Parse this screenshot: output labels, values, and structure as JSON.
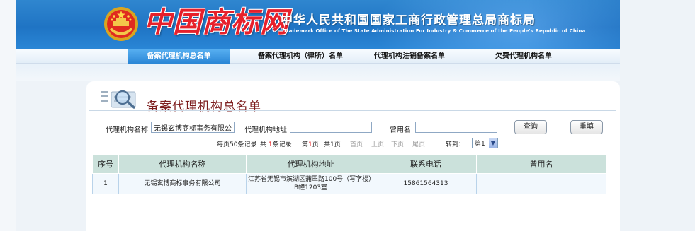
{
  "header": {
    "logo_text": "中国商标网",
    "org_cn": "中华人民共和国国家工商行政管理总局商标局",
    "org_en": "Trademark Office of The State Administration For Industry & Commerce of the People's Republic of China",
    "colors": {
      "banner": "#1f74c4",
      "logo": "#e6202b"
    }
  },
  "nav": {
    "items": [
      {
        "label": "备案代理机构总名单",
        "active": true
      },
      {
        "label": "备案代理机构（律所）名单",
        "active": false
      },
      {
        "label": "代理机构注销备案名单",
        "active": false
      },
      {
        "label": "欠费代理机构名单",
        "active": false
      }
    ]
  },
  "page": {
    "title": "备案代理机构总名单",
    "title_icon": "magnifier-doc-icon"
  },
  "search": {
    "name_label": "代理机构名称",
    "name_value": "无锡玄博商标事务有限公司",
    "address_label": "代理机构地址",
    "address_value": "",
    "alias_label": "曾用名",
    "alias_value": "",
    "query_button": "查询",
    "reset_button": "重填"
  },
  "pager": {
    "per_page_prefix": "每页",
    "per_page": "50",
    "per_page_suffix": "条记录",
    "total_prefix": "共",
    "total": "1",
    "total_suffix": "条记录",
    "current_prefix": "第",
    "current": "1",
    "current_suffix": "页",
    "pages_text": "共1页",
    "first": "首页",
    "prev": "上页",
    "next": "下页",
    "last": "尾页",
    "goto_label": "转到：",
    "goto_value": "第1"
  },
  "table": {
    "headers": [
      "序号",
      "代理机构名称",
      "代理机构地址",
      "联系电话",
      "曾用名"
    ],
    "rows": [
      {
        "no": "1",
        "name": "无锡玄博商标事务有限公司",
        "address_line1": "江苏省无锡市滨湖区蒲翠路100号（写字楼）",
        "address_line2": "B幢1203室",
        "phone": "15861564313",
        "alias": ""
      }
    ]
  }
}
